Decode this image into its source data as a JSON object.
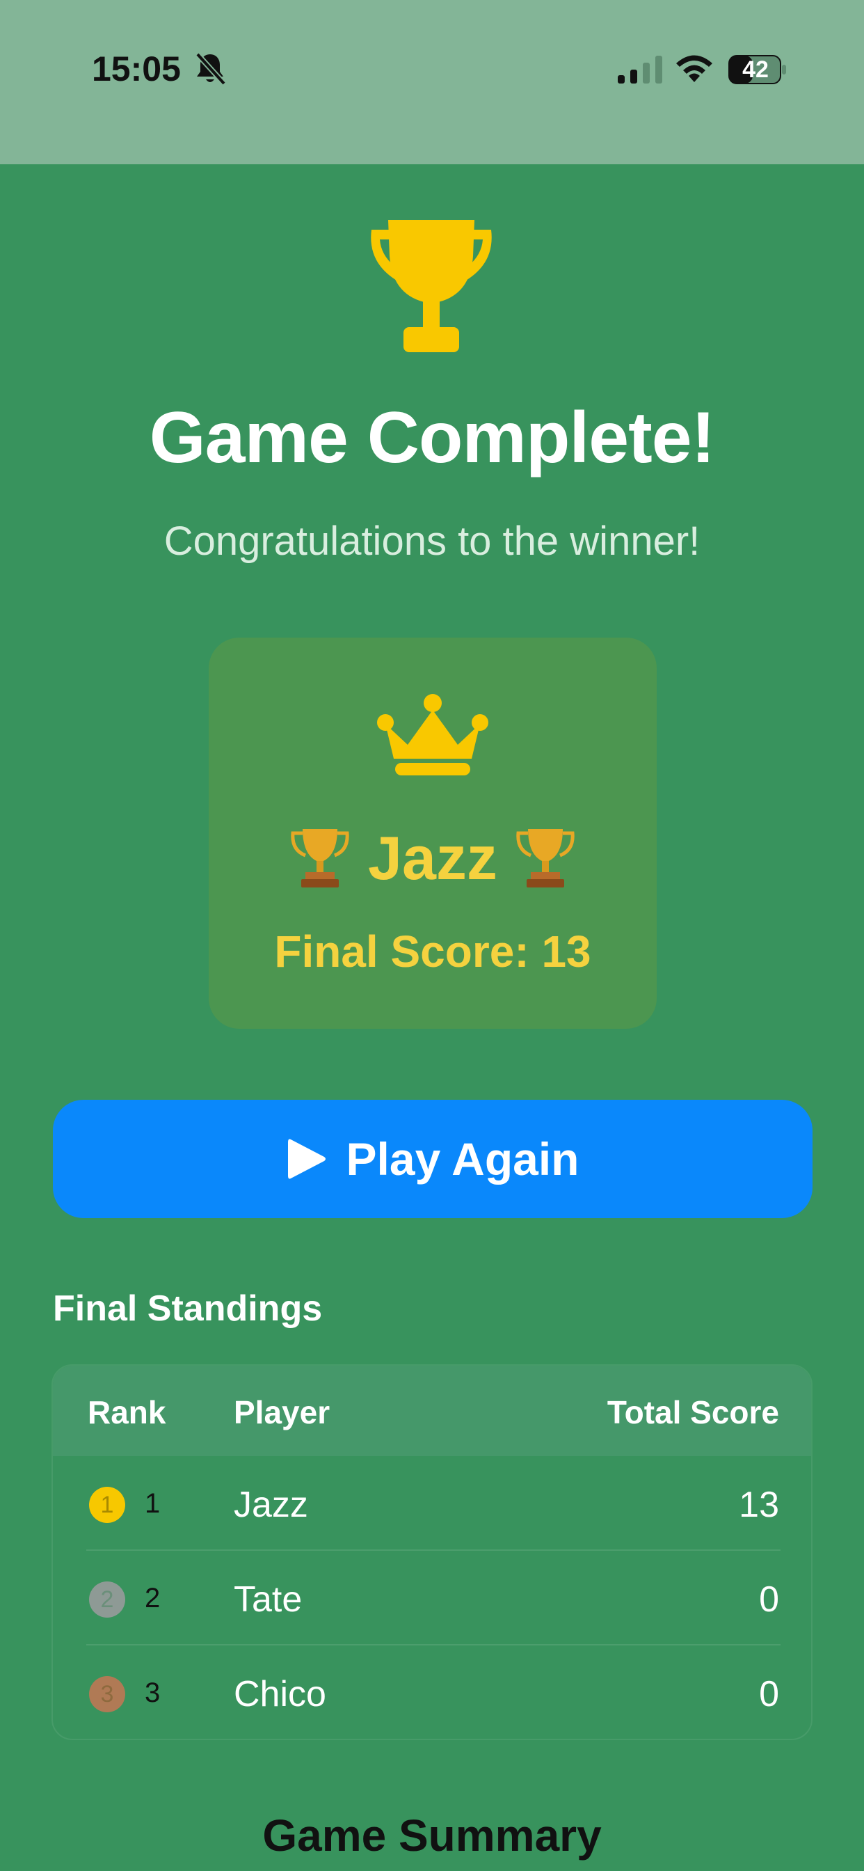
{
  "status_bar": {
    "time": "15:05",
    "battery": "42",
    "icons": [
      "bell-slash-icon",
      "signal-icon",
      "wifi-icon",
      "battery-icon"
    ]
  },
  "hero": {
    "icon": "trophy-icon",
    "title": "Game Complete!",
    "subtitle": "Congratulations to the winner!"
  },
  "winner": {
    "icon": "crown-icon",
    "name": "Jazz",
    "score_text": "Final Score: 13"
  },
  "play_again": {
    "icon": "play-icon",
    "label": "Play Again"
  },
  "standings": {
    "title": "Final Standings",
    "columns": [
      "Rank",
      "Player",
      "Total Score"
    ],
    "rows": [
      {
        "badge": "1",
        "rank": "1",
        "player": "Jazz",
        "score": "13",
        "badge_color": "#f7c800",
        "badge_text_color": "#a88a00"
      },
      {
        "badge": "2",
        "rank": "2",
        "player": "Tate",
        "score": "0",
        "badge_color": "#8e9a95",
        "badge_text_color": "#6b8f7a"
      },
      {
        "badge": "3",
        "rank": "3",
        "player": "Chico",
        "score": "0",
        "badge_color": "#b07a55",
        "badge_text_color": "#8e6a3e"
      }
    ]
  },
  "summary": {
    "title": "Game Summary"
  },
  "colors": {
    "background": "#38935d",
    "status_bar": "#83b597",
    "accent_gold": "#f5d23f",
    "trophy_gold": "#f9c800",
    "button_blue": "#0a88fb"
  }
}
